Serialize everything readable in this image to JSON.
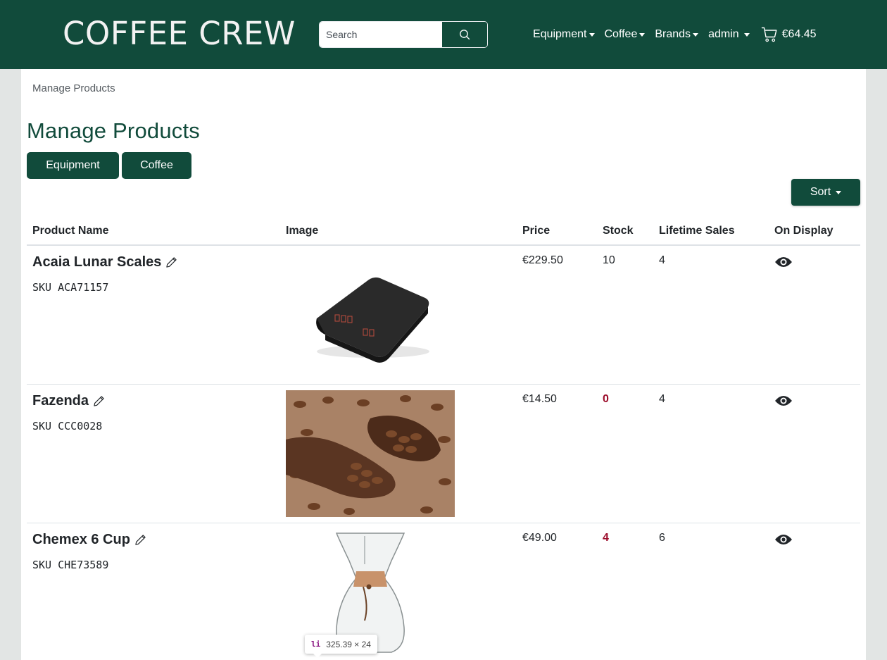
{
  "header": {
    "brand": "COFFEE CREW",
    "search_placeholder": "Search",
    "nav": [
      {
        "label": "Equipment"
      },
      {
        "label": "Coffee"
      },
      {
        "label": "Brands"
      },
      {
        "label": "admin"
      }
    ],
    "cart_total": "€64.45"
  },
  "breadcrumb": "Manage Products",
  "page_title": "Manage Products",
  "category_buttons": [
    "Equipment",
    "Coffee"
  ],
  "sort_label": "Sort",
  "table": {
    "columns": [
      "Product Name",
      "Image",
      "Price",
      "Stock",
      "Lifetime Sales",
      "On Display"
    ],
    "rows": [
      {
        "name": "Acaia Lunar Scales",
        "sku": "SKU ACA71157",
        "price": "€229.50",
        "stock": "10",
        "sales": "4",
        "low_stock": false
      },
      {
        "name": "Fazenda",
        "sku": "SKU CCC0028",
        "price": "€14.50",
        "stock": "0",
        "sales": "4",
        "low_stock": true
      },
      {
        "name": "Chemex 6 Cup",
        "sku": "SKU CHE73589",
        "price": "€49.00",
        "stock": "4",
        "sales": "6",
        "low_stock": true
      }
    ]
  },
  "tooltip": {
    "tag": "li",
    "size": "325.39 × 24"
  },
  "colors": {
    "brand_green": "#114b3b",
    "low_stock_red": "#9c0d2b"
  }
}
